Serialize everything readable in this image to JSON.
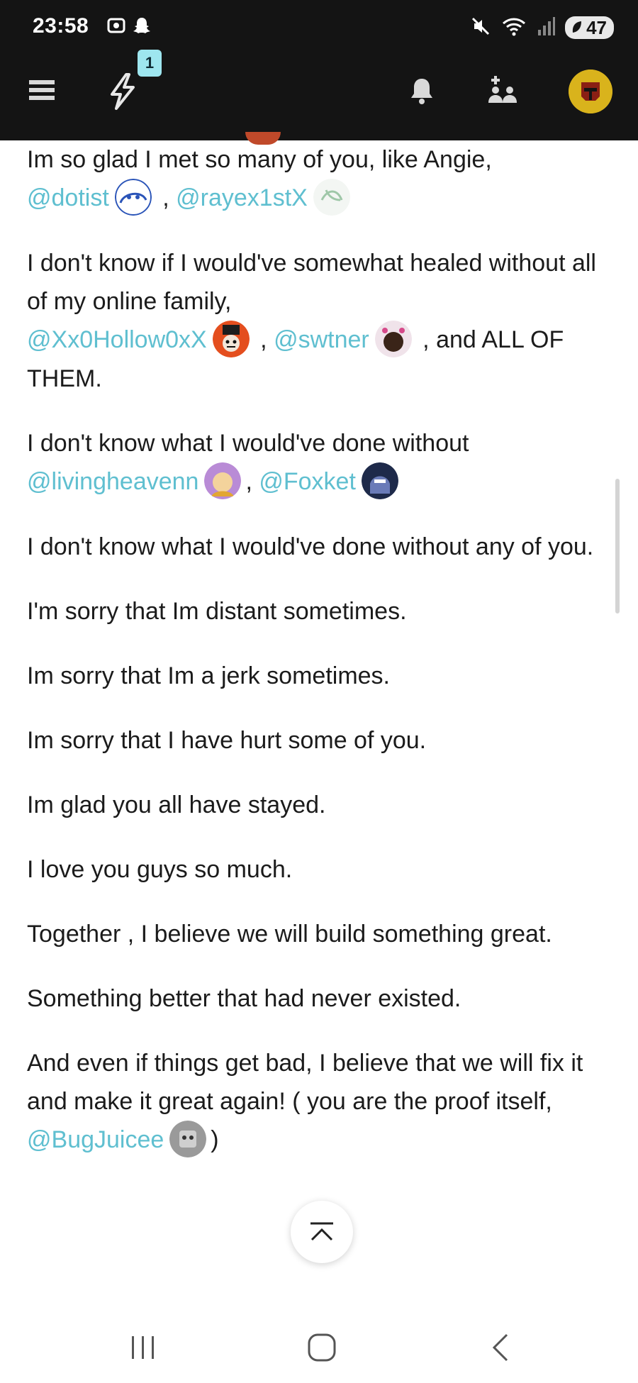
{
  "status_bar": {
    "time": "23:58",
    "icons_left": [
      "screenshot-icon",
      "snapchat-icon"
    ],
    "icons_right": [
      "mute-icon",
      "wifi-icon",
      "signal-icon"
    ],
    "battery": "47"
  },
  "app_bar": {
    "notification_badge": "1"
  },
  "content": {
    "p1": {
      "text": "Im so glad I met so many of you, like Angie,",
      "m1": "@dotist",
      "sep": " , ",
      "m2": "@rayex1stX"
    },
    "p2": {
      "text": "I don't know if I would've somewhat healed without all of my online family,",
      "m1": "@Xx0Hollow0xX",
      "sep": " , ",
      "m2": "@swtner",
      "tail": " , and ALL OF THEM."
    },
    "p3": {
      "text": "I don't know what I would've done without",
      "m1": "@livingheavenn",
      "sep": ", ",
      "m2": "@Foxket"
    },
    "p4": "I don't know what I would've done without any of you.",
    "p5": "I'm sorry that Im distant sometimes.",
    "p6": "Im sorry that Im a jerk sometimes.",
    "p7": "Im sorry that I have hurt some of you.",
    "p8": "Im glad you all have stayed.",
    "p9": "I love you guys so much.",
    "p10": "Together , I believe we will build something great.",
    "p11": "Something better that had never existed.",
    "p12": {
      "text": "And even if things get bad, I believe that we will fix it and make it great again! ( you are the proof itself,",
      "m1": "@BugJuicee",
      "tail": ")"
    }
  },
  "colors": {
    "mention": "#5fbfd0",
    "app_bar": "#141414",
    "badge": "#9ee6ef"
  }
}
